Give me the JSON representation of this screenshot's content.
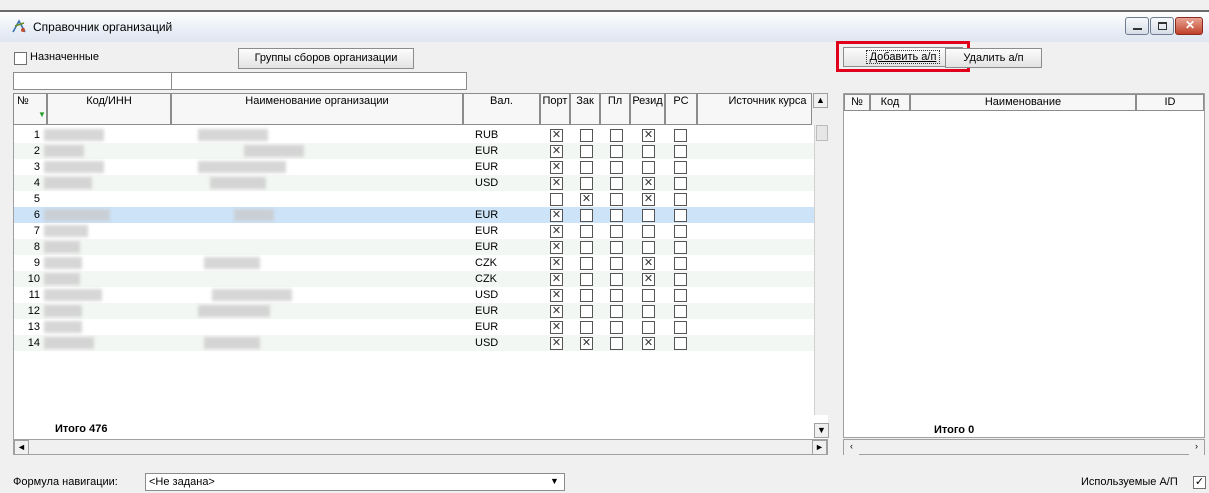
{
  "window": {
    "title": "Справочник организаций"
  },
  "toolbar": {
    "assigned_label": "Назначенные",
    "groups_button": "Группы сборов организации",
    "add_button": "Добавить а/п",
    "remove_button": "Удалить а/п"
  },
  "left_grid": {
    "headers": {
      "num": "№",
      "code": "Код/ИНН",
      "name": "Наименование организации",
      "cur": "Вал.",
      "port": "Порт",
      "zak": "Зак",
      "pl": "Пл",
      "rezid": "Резид",
      "pc": "РС",
      "source": "Источник курса"
    },
    "rows": [
      {
        "n": "1",
        "cur": "RUB",
        "port": true,
        "zak": false,
        "pl": false,
        "rezid": true,
        "pc": false
      },
      {
        "n": "2",
        "cur": "EUR",
        "port": true,
        "zak": false,
        "pl": false,
        "rezid": false,
        "pc": false
      },
      {
        "n": "3",
        "cur": "EUR",
        "port": true,
        "zak": false,
        "pl": false,
        "rezid": false,
        "pc": false
      },
      {
        "n": "4",
        "cur": "USD",
        "port": true,
        "zak": false,
        "pl": false,
        "rezid": true,
        "pc": false
      },
      {
        "n": "5",
        "cur": "",
        "port": false,
        "zak": true,
        "pl": false,
        "rezid": true,
        "pc": false
      },
      {
        "n": "6",
        "cur": "EUR",
        "port": true,
        "zak": false,
        "pl": false,
        "rezid": false,
        "pc": false
      },
      {
        "n": "7",
        "cur": "EUR",
        "port": true,
        "zak": false,
        "pl": false,
        "rezid": false,
        "pc": false
      },
      {
        "n": "8",
        "cur": "EUR",
        "port": true,
        "zak": false,
        "pl": false,
        "rezid": false,
        "pc": false
      },
      {
        "n": "9",
        "cur": "CZK",
        "port": true,
        "zak": false,
        "pl": false,
        "rezid": true,
        "pc": false
      },
      {
        "n": "10",
        "cur": "CZK",
        "port": true,
        "zak": false,
        "pl": false,
        "rezid": true,
        "pc": false
      },
      {
        "n": "11",
        "cur": "USD",
        "port": true,
        "zak": false,
        "pl": false,
        "rezid": false,
        "pc": false
      },
      {
        "n": "12",
        "cur": "EUR",
        "port": true,
        "zak": false,
        "pl": false,
        "rezid": false,
        "pc": false
      },
      {
        "n": "13",
        "cur": "EUR",
        "port": true,
        "zak": false,
        "pl": false,
        "rezid": false,
        "pc": false
      },
      {
        "n": "14",
        "cur": "USD",
        "port": true,
        "zak": true,
        "pl": false,
        "rezid": true,
        "pc": false
      }
    ],
    "total": "Итого 476"
  },
  "right_grid": {
    "headers": {
      "num": "№",
      "code": "Код",
      "name": "Наименование",
      "id": "ID"
    },
    "total": "Итого 0"
  },
  "footer": {
    "formula_label": "Формула навигации:",
    "formula_value": "<Не задана>",
    "used_label": "Используемые А/П"
  },
  "colors": {
    "selected_row": "#cde3f8",
    "highlight_border": "#e0001b"
  }
}
